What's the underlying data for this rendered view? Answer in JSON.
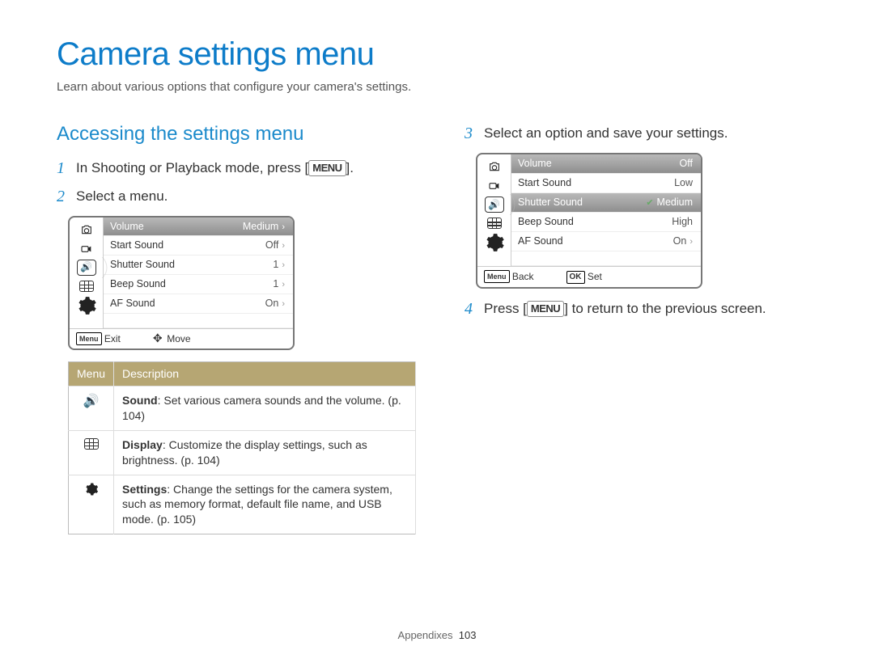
{
  "page": {
    "title": "Camera settings menu",
    "subtitle": "Learn about various options that configure your camera's settings.",
    "footer_section": "Appendixes",
    "footer_page": "103"
  },
  "section": {
    "heading": "Accessing the settings menu"
  },
  "steps": {
    "s1_num": "1",
    "s1_a": "In Shooting or Playback mode, press [",
    "s1_b": "].",
    "menu_label": "MENU",
    "s2_num": "2",
    "s2": "Select a menu.",
    "s3_num": "3",
    "s3": "Select an option and save your settings.",
    "s4_num": "4",
    "s4_a": "Press [",
    "s4_b": "] to return to the previous screen."
  },
  "lcd1": {
    "rows": [
      {
        "label": "Volume",
        "value": "Medium"
      },
      {
        "label": "Start Sound",
        "value": "Off"
      },
      {
        "label": "Shutter Sound",
        "value": "1"
      },
      {
        "label": "Beep Sound",
        "value": "1"
      },
      {
        "label": "AF Sound",
        "value": "On"
      }
    ],
    "foot_left_badge": "Menu",
    "foot_left": "Exit",
    "foot_right": "Move"
  },
  "lcd2": {
    "left_label": "Volume",
    "rows_left": [
      "Start Sound",
      "Shutter Sound",
      "Beep Sound",
      "AF Sound"
    ],
    "options": [
      "Off",
      "Low",
      "Medium",
      "High"
    ],
    "option_selected_index": 2,
    "extra_right": "On",
    "foot_left_badge": "Menu",
    "foot_left": "Back",
    "foot_right_badge": "OK",
    "foot_right": "Set"
  },
  "desc_table": {
    "head_menu": "Menu",
    "head_desc": "Description",
    "rows": [
      {
        "bold": "Sound",
        "text": ": Set various camera sounds and the volume. ",
        "page": "(p. 104)"
      },
      {
        "bold": "Display",
        "text": ": Customize the display settings, such as brightness. ",
        "page": "(p. 104)"
      },
      {
        "bold": "Settings",
        "text": ": Change the settings for the camera system, such as memory format, default file name, and USB mode. ",
        "page": "(p. 105)"
      }
    ]
  }
}
